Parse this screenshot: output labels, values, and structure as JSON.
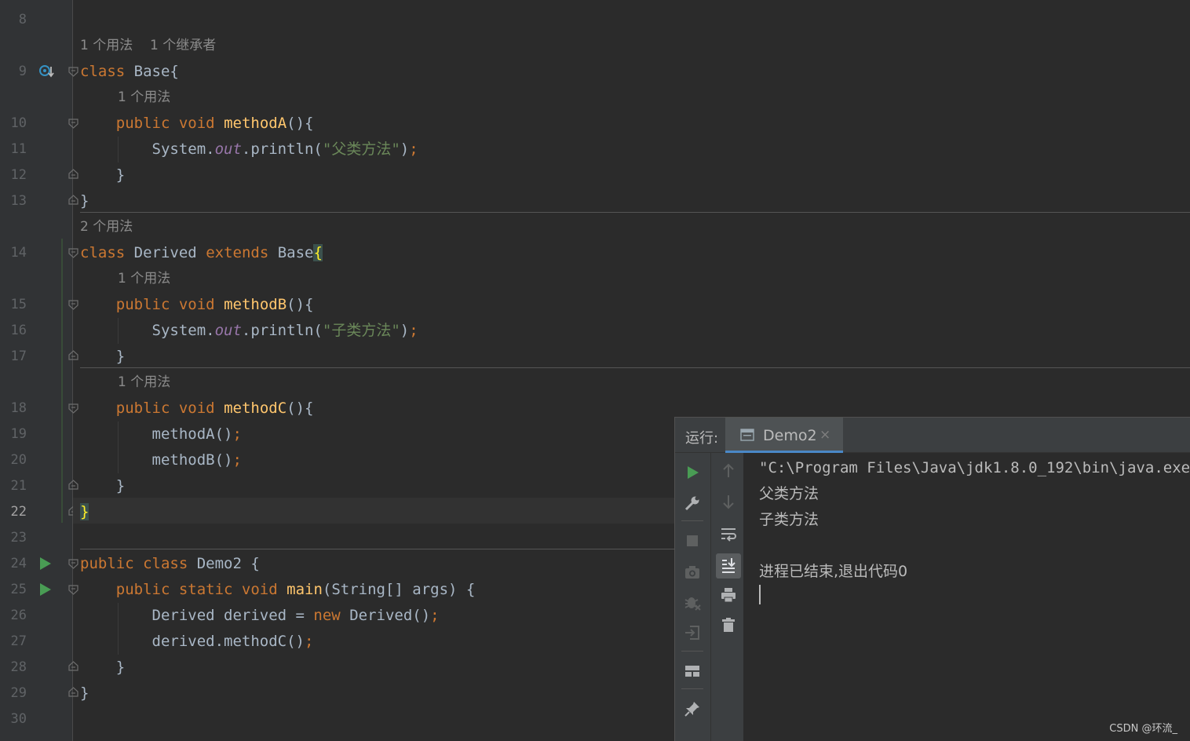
{
  "editor": {
    "line_numbers": [
      "8",
      "9",
      "10",
      "11",
      "12",
      "13",
      "14",
      "15",
      "16",
      "17",
      "18",
      "19",
      "20",
      "21",
      "22",
      "23",
      "24",
      "25",
      "26",
      "27",
      "28",
      "29",
      "30"
    ],
    "current_line": "22",
    "hints": {
      "base_usages": "1 个用法",
      "base_inheritors": "1 个继承者",
      "methodA_usages": "1 个用法",
      "derived_usages": "2 个用法",
      "methodB_usages": "1 个用法",
      "methodC_usages": "1 个用法"
    },
    "code": {
      "class_kw": "class",
      "base_name": "Base",
      "open_brace": "{",
      "close_brace": "}",
      "public_void": "public void",
      "methodA": "methodA",
      "methodB": "methodB",
      "methodC": "methodC",
      "parens_brace": "(){",
      "system": "System.",
      "out": "out",
      "println": ".println(",
      "str_parent": "\"父类方法\"",
      "str_child": "\"子类方法\"",
      "close_paren": ")",
      "semi": ";",
      "derived_name": "Derived",
      "extends_kw": "extends",
      "call_a": "methodA()",
      "call_b": "methodB()",
      "public_class": "public class",
      "demo2": "Demo2 {",
      "public_static_void": "public static void",
      "main": "main",
      "main_args": "(String[] args) {",
      "derived_decl": "Derived derived = ",
      "new_kw": "new",
      "derived_ctor": " Derived()",
      "derived_call": "derived.methodC()"
    }
  },
  "run_panel": {
    "title": "运行:",
    "tab_label": "Demo2",
    "tab_close": "×",
    "console_lines": [
      "\"C:\\Program Files\\Java\\jdk1.8.0_192\\bin\\java.exe\"",
      "父类方法",
      "子类方法",
      "",
      "进程已结束,退出代码0"
    ]
  },
  "watermark": "CSDN @环流_",
  "colors": {
    "keyword": "#cc7832",
    "method": "#ffc66d",
    "string": "#6a8759",
    "field": "#9876aa",
    "text": "#a9b7c6",
    "run_green": "#499c54",
    "tab_underline": "#4a88c7"
  },
  "icons": {
    "gutter_impl": "implemented-override-icon",
    "gutter_run": "run-gutter-icon",
    "toolbar": [
      "rerun-icon",
      "settings-wrench-icon",
      "stop-icon",
      "screenshot-camera-icon",
      "debug-bug-icon",
      "restore-layout-icon",
      "layout-icon",
      "pin-icon"
    ],
    "toolbar2": [
      "up-arrow-icon",
      "down-arrow-icon",
      "soft-wrap-icon",
      "scroll-to-end-icon",
      "print-icon",
      "clear-trash-icon"
    ]
  }
}
